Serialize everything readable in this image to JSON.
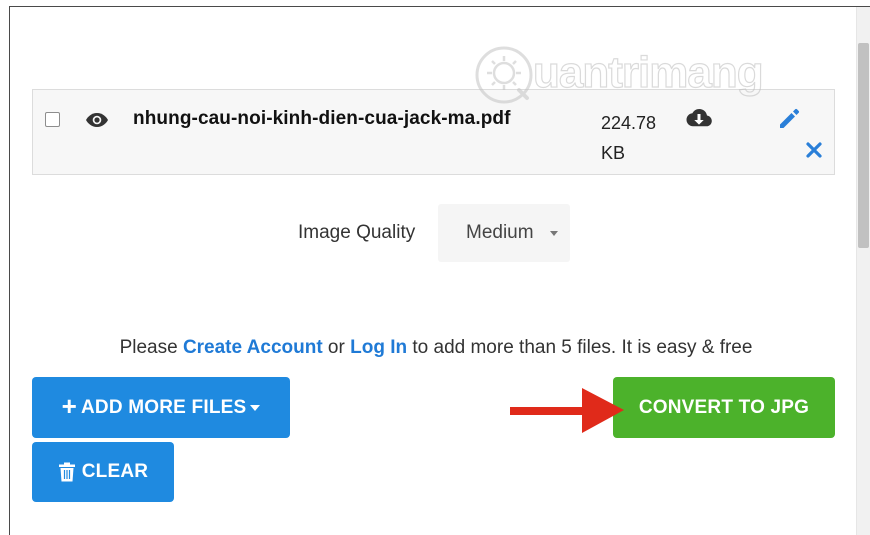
{
  "file": {
    "name": "nhung-cau-noi-kinh-dien-cua-jack-ma.pdf",
    "size_value": "224.78",
    "size_unit": "KB"
  },
  "watermark": {
    "text": "uantrimang"
  },
  "options": {
    "quality_label": "Image Quality",
    "quality_value": "Medium"
  },
  "notice": {
    "prefix": "Please ",
    "create_account": "Create Account",
    "middle": " or ",
    "log_in": "Log In",
    "suffix": " to add more than 5 files. It is easy & free"
  },
  "buttons": {
    "add_more": "ADD MORE FILES",
    "clear": "CLEAR",
    "convert": "CONVERT TO JPG"
  },
  "colors": {
    "primary_blue": "#1f8ae0",
    "convert_green": "#4cb22b",
    "link_blue": "#1f7ad6",
    "arrow_red": "#e02a1a"
  },
  "icons": {
    "preview": "eye-icon",
    "download": "cloud-download-icon",
    "edit": "pencil-icon",
    "remove": "close-icon",
    "add": "plus-icon",
    "clear": "trash-icon"
  }
}
